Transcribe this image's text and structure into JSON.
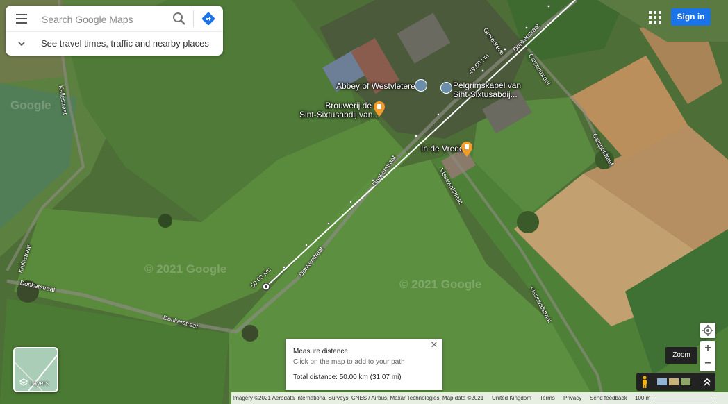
{
  "search": {
    "placeholder": "Search Google Maps"
  },
  "travel": {
    "label": "See travel times, traffic and nearby places"
  },
  "header": {
    "sign_in_label": "Sign in"
  },
  "pois": [
    {
      "name": "Abbey of Westvleteren",
      "icon": "abbey-icon"
    },
    {
      "name": "Pelgrimskapel van Sint-Sixtusabdij...",
      "line1": "Pelgrimskapel van",
      "line2": "Sint-Sixtusabdij...",
      "icon": "chapel-icon"
    },
    {
      "name": "Brouwerij de Sint-Sixtusabdij van...",
      "line1": "Brouwerij de",
      "line2": "Sint-Sixtusabdij van...",
      "icon": "beer-icon"
    },
    {
      "name": "In de Vrede",
      "icon": "beer-icon"
    }
  ],
  "roads": [
    "Donkerstraat",
    "Donkerstraat",
    "Donkerstraat",
    "Donkerstraat",
    "Kallestraat",
    "Kallestraat",
    "Grotedreve",
    "Catsputdreef",
    "Catsputdreef",
    "Vissewalstraat",
    "Vissewalstraat"
  ],
  "measure_path": {
    "start_label": "50.00 km",
    "end_label": "49.50 km"
  },
  "watermark": [
    "Google",
    "© 2021 Google",
    "© 2021 Google"
  ],
  "measure": {
    "title": "Measure distance",
    "hint": "Click on the map to add to your path",
    "total": "Total distance: 50.00 km (31.07 mi)"
  },
  "controls": {
    "zoom_tooltip": "Zoom",
    "layers_label": "Layers"
  },
  "attribution": {
    "imagery": "Imagery ©2021 Aerodata International Surveys, CNES / Airbus, Maxar Technologies, Map data ©2021",
    "region": "United Kingdom",
    "terms": "Terms",
    "privacy": "Privacy",
    "feedback": "Send feedback",
    "scale": "100 m"
  },
  "colors": {
    "accent": "#1a73e8",
    "poi_orange": "#f29b28",
    "poi_blue": "#4a90c8"
  }
}
